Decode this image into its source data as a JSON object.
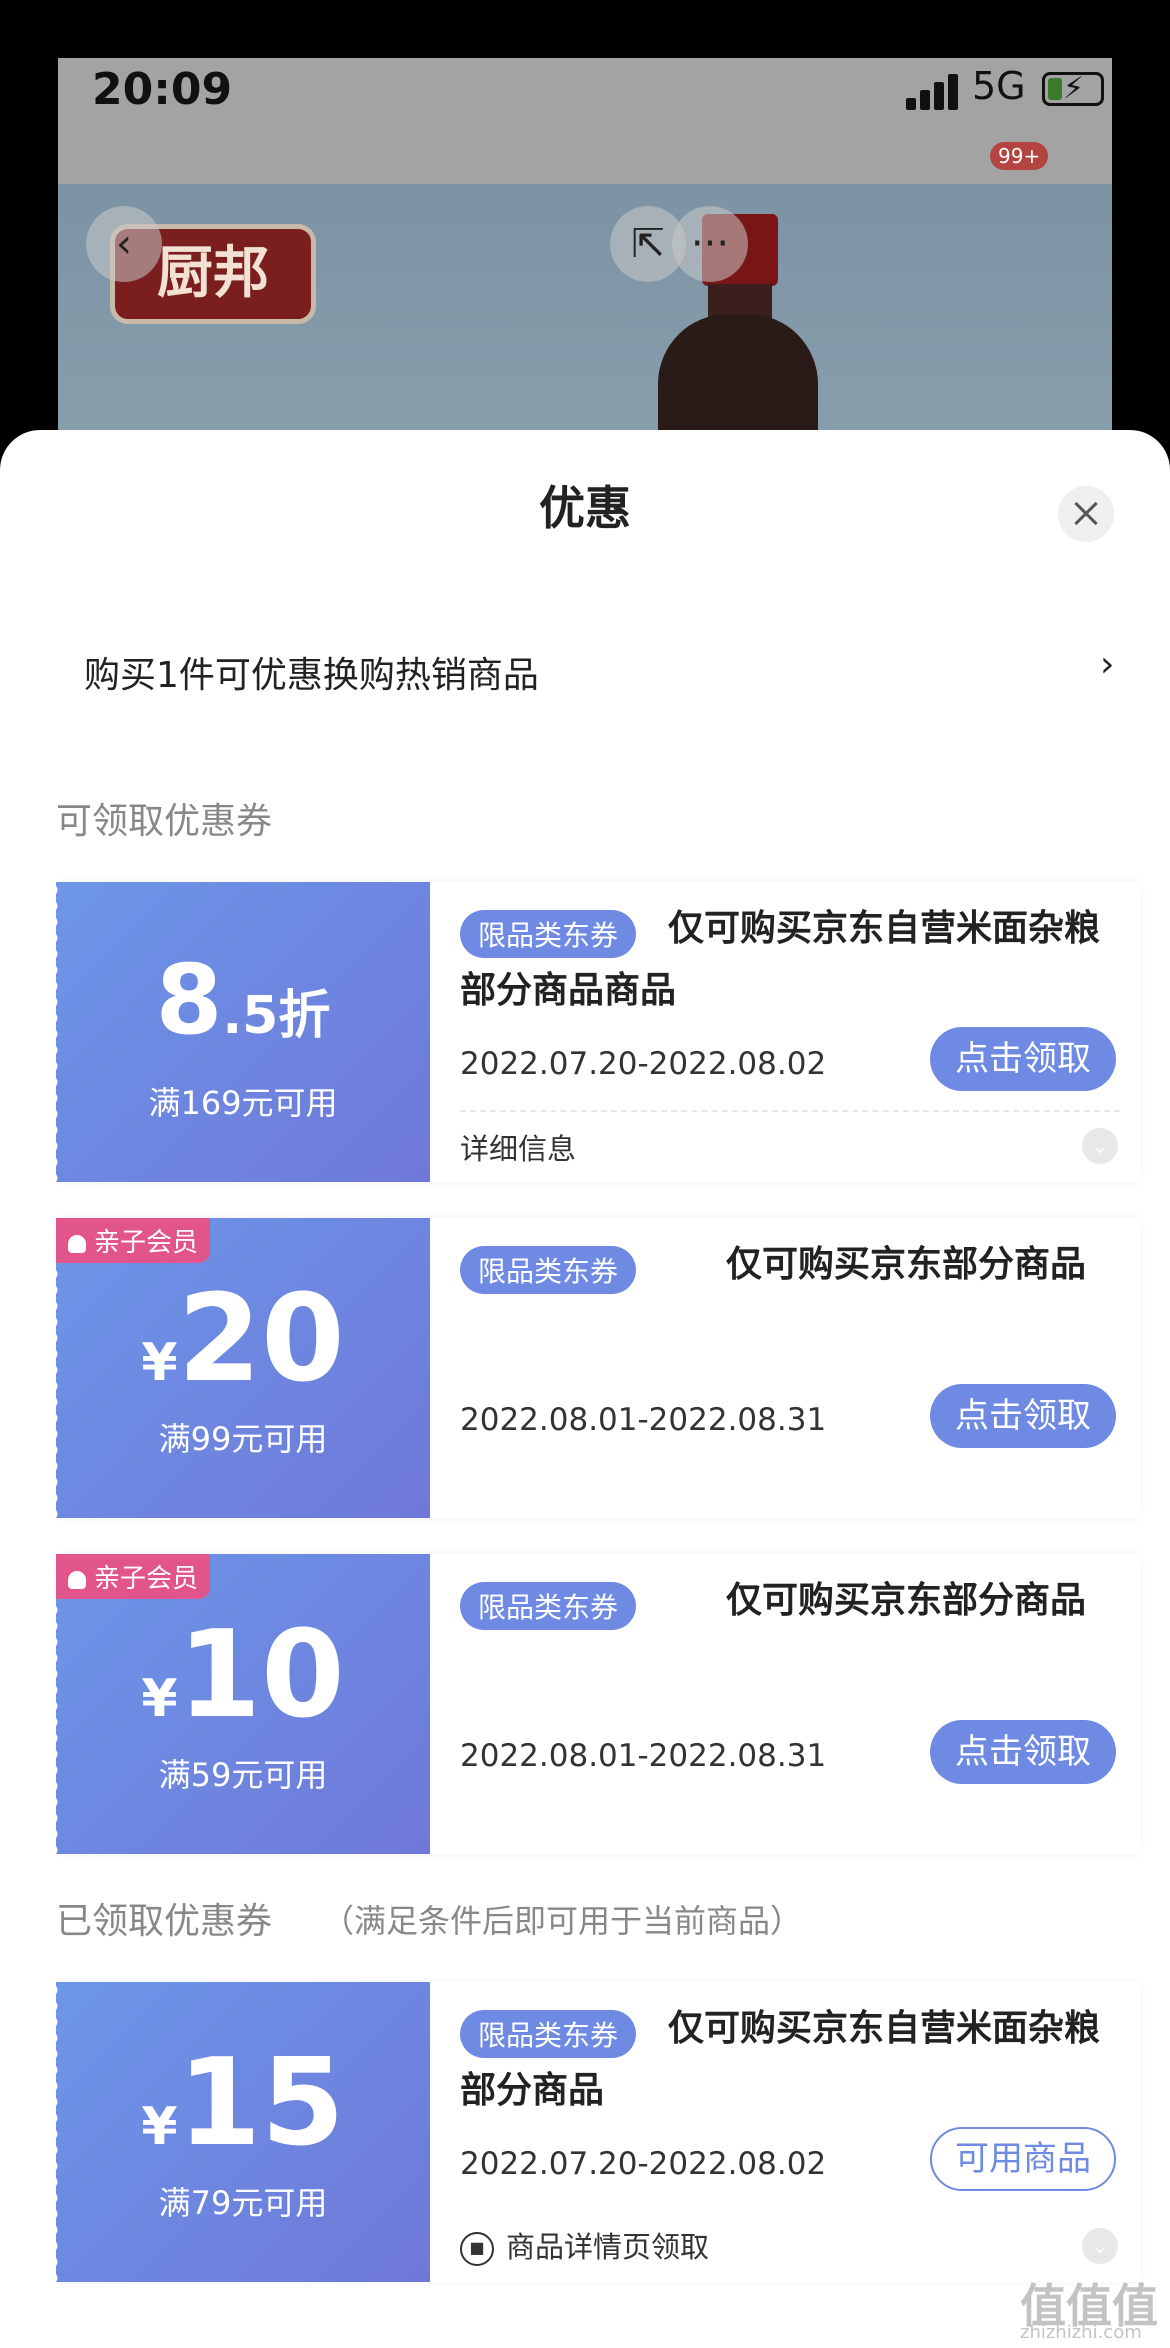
{
  "status": {
    "time": "20:09",
    "network": "5G"
  },
  "product_header": {
    "brand_logo": "厨邦",
    "notification_badge": "99+"
  },
  "sheet": {
    "title": "优惠",
    "promo": "购买1件可优惠换购热销商品",
    "promo_arrow": "›",
    "available_label": "可领取优惠券",
    "claimed_label": "已领取优惠券",
    "claimed_note": "（满足条件后即可用于当前商品）"
  },
  "coupons": [
    {
      "member": "",
      "amount_main": "8",
      "amount_sub": ".5折",
      "condition": "满169元可用",
      "tag": "限品类东券",
      "desc": "仅可购买京东自营米面杂粮部分商品商品",
      "dates": "2022.07.20-2022.08.02",
      "button": "点击领取",
      "detail": "详细信息"
    },
    {
      "member": "亲子会员",
      "currency": "¥",
      "amount_main": "20",
      "condition": "满99元可用",
      "tag": "限品类东券",
      "desc": "仅可购买京东部分商品",
      "dates": "2022.08.01-2022.08.31",
      "button": "点击领取"
    },
    {
      "member": "亲子会员",
      "currency": "¥",
      "amount_main": "10",
      "condition": "满59元可用",
      "tag": "限品类东券",
      "desc": "仅可购买京东部分商品",
      "dates": "2022.08.01-2022.08.31",
      "button": "点击领取"
    },
    {
      "member": "",
      "currency": "¥",
      "amount_main": "15",
      "condition": "满79元可用",
      "tag": "限品类东券",
      "desc": "仅可购买京东自营米面杂粮部分商品",
      "dates": "2022.07.20-2022.08.02",
      "button": "可用商品",
      "source": "商品详情页领取"
    }
  ],
  "watermark": {
    "main": "值值值",
    "sub": "zhizhizhi.com"
  },
  "colors": {
    "accent": "#6f8ae2",
    "member_badge": "#e2558a"
  }
}
